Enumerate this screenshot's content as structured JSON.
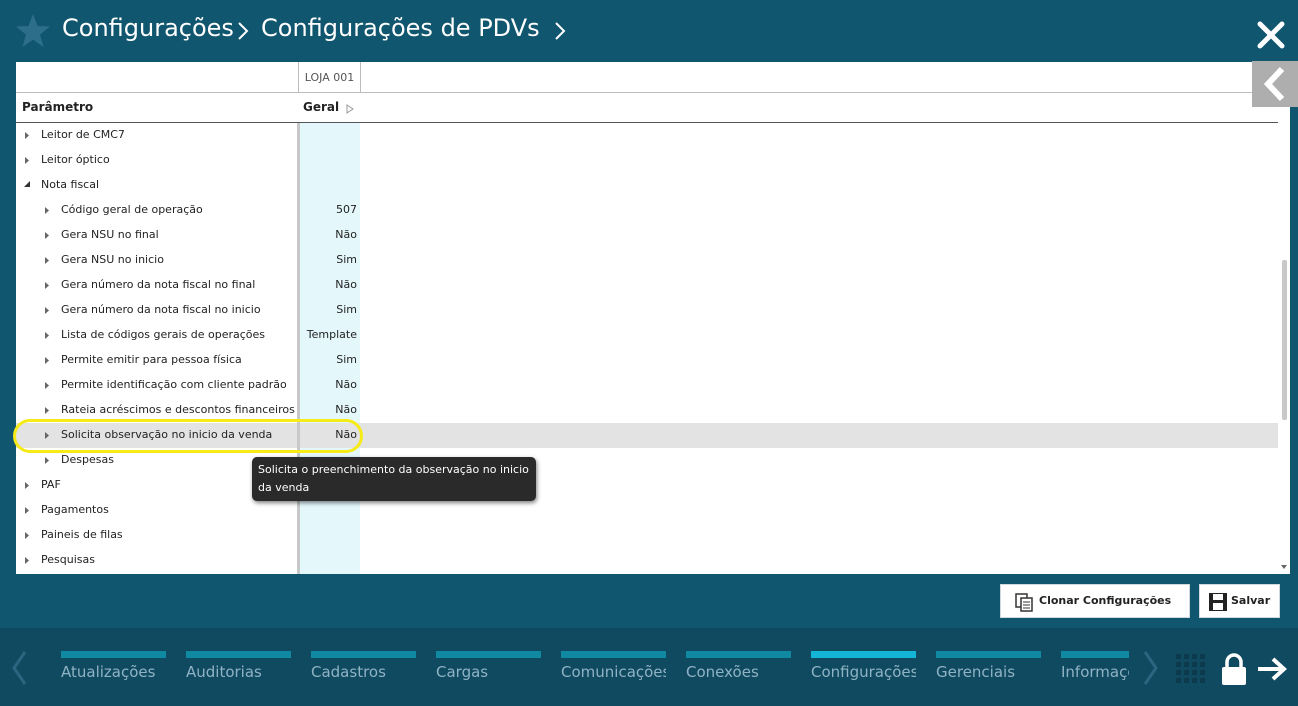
{
  "header": {
    "breadcrumb": [
      "Configurações",
      "Configurações de PDVs"
    ]
  },
  "table": {
    "store_header": "LOJA 001",
    "param_header": "Parâmetro",
    "value_header": "Geral",
    "rows": [
      {
        "label": "Leitor de CMC7",
        "value": "",
        "level": 0,
        "expanded": false
      },
      {
        "label": "Leitor óptico",
        "value": "",
        "level": 0,
        "expanded": false
      },
      {
        "label": "Nota fiscal",
        "value": "",
        "level": 0,
        "expanded": true
      },
      {
        "label": "Código geral de operação",
        "value": "507",
        "level": 1,
        "expanded": false
      },
      {
        "label": "Gera NSU no final",
        "value": "Não",
        "level": 1,
        "expanded": false
      },
      {
        "label": "Gera NSU no inicio",
        "value": "Sim",
        "level": 1,
        "expanded": false
      },
      {
        "label": "Gera número da nota fiscal no final",
        "value": "Não",
        "level": 1,
        "expanded": false
      },
      {
        "label": "Gera número da nota fiscal no inicio",
        "value": "Sim",
        "level": 1,
        "expanded": false
      },
      {
        "label": "Lista de códigos gerais de operações",
        "value": "Template",
        "level": 1,
        "expanded": false
      },
      {
        "label": "Permite emitir para pessoa física",
        "value": "Sim",
        "level": 1,
        "expanded": false
      },
      {
        "label": "Permite identificação com cliente padrão",
        "value": "Não",
        "level": 1,
        "expanded": false
      },
      {
        "label": "Rateia acréscimos e descontos financeiros",
        "value": "Não",
        "level": 1,
        "expanded": false
      },
      {
        "label": "Solicita observação no inicio da venda",
        "value": "Não",
        "level": 1,
        "expanded": false,
        "selected": true
      },
      {
        "label": "Despesas",
        "value": "",
        "level": 1,
        "expanded": false
      },
      {
        "label": "PAF",
        "value": "",
        "level": 0,
        "expanded": false
      },
      {
        "label": "Pagamentos",
        "value": "",
        "level": 0,
        "expanded": false
      },
      {
        "label": "Paineis de filas",
        "value": "",
        "level": 0,
        "expanded": false
      },
      {
        "label": "Pesquisas",
        "value": "",
        "level": 0,
        "expanded": false
      }
    ]
  },
  "tooltip": {
    "line1": "Solicita o preenchimento da observação no inicio",
    "line2": "da venda"
  },
  "actions": {
    "clone_label": "Clonar Configurações",
    "save_label": "Salvar"
  },
  "bottom_nav": {
    "tabs": [
      {
        "label": "Atualizações",
        "active": false
      },
      {
        "label": "Auditorias",
        "active": false
      },
      {
        "label": "Cadastros",
        "active": false
      },
      {
        "label": "Cargas",
        "active": false
      },
      {
        "label": "Comunicações",
        "active": false
      },
      {
        "label": "Conexões",
        "active": false
      },
      {
        "label": "Configurações",
        "active": true
      },
      {
        "label": "Gerenciais",
        "active": false
      },
      {
        "label": "Informações",
        "active": false
      }
    ]
  },
  "icons": {
    "favorite": "star-icon",
    "close": "close-icon",
    "collapse_panel": "chevron-left-icon",
    "clone": "clone-icon",
    "save": "save-icon",
    "nav_prev": "chevron-left-icon",
    "nav_next": "chevron-right-icon",
    "apps": "grid-icon",
    "lock": "lock-icon",
    "exit": "exit-arrow-icon"
  },
  "colors": {
    "background": "#11566f",
    "bottom_bar": "#104a60",
    "tab_bar": "#0f8aa2",
    "tab_bar_active": "#14b4d6",
    "value_column": "#e4f8fc",
    "selected_row": "#e3e3e3",
    "highlight_ring": "#f6ea18",
    "tooltip": "#2a2a2a"
  }
}
